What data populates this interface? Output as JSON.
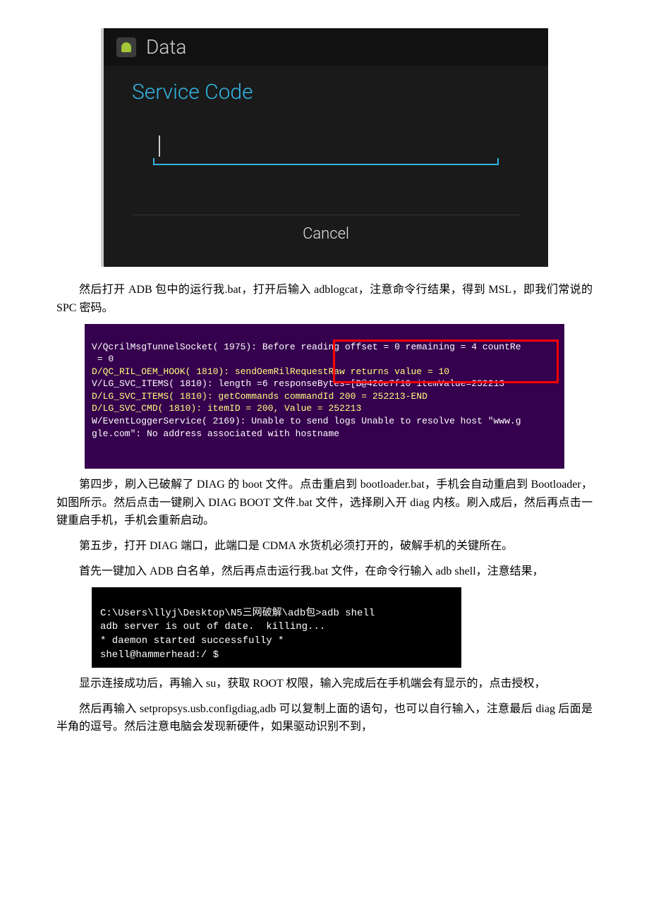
{
  "screenshot1": {
    "title": "Data",
    "label": "Service Code",
    "cancel": "Cancel"
  },
  "para1": "然后打开 ADB 包中的运行我.bat，打开后输入 adblogcat，注意命令行结果，得到 MSL，即我们常说的 SPC 密码。",
  "terminal1": {
    "l1a": "V/QcrilMsgTunnelSocket( 1975): Before reading offset = 0 remaining = 4 countRe",
    "l1b": " = 0",
    "l2": "D/QC_RIL_OEM_HOOK( 1810): sendOemRilRequestRaw returns value = 10",
    "l3": "V/LG_SVC_ITEMS( 1810): length =6 responseBytes=[B@426e7f10 itemValue=252213",
    "l4": "D/LG_SVC_ITEMS( 1810): getCommands commandId 200 = 252213-END",
    "l5": "D/LG_SVC_CMD( 1810): itemID = 200, Value = 252213",
    "l6a": "W/EventLoggerService( 2169): Unable to send logs Unable to resolve host \"www.g",
    "l6b": "gle.com\": No address associated with hostname"
  },
  "para2": "第四步，刷入已破解了 DIAG 的 boot 文件。点击重启到 bootloader.bat，手机会自动重启到 Bootloader，如图所示。然后点击一键刷入 DIAG BOOT 文件.bat 文件，选择刷入开 diag 内核。刷入成后，然后再点击一键重启手机，手机会重新启动。",
  "para3": "第五步，打开 DIAG 端口，此端口是 CDMA 水货机必须打开的，破解手机的关键所在。",
  "para4": "首先一键加入 ADB 白名单，然后再点击运行我.bat 文件，在命令行输入 adb shell，注意结果，",
  "terminal2": {
    "l1": "C:\\Users\\llyj\\Desktop\\N5三网破解\\adb包>adb shell",
    "l2": "adb server is out of date.  killing...",
    "l3": "* daemon started successfully *",
    "l4": "shell@hammerhead:/ $"
  },
  "para5": "显示连接成功后，再输入 su，获取 ROOT 权限，输入完成后在手机端会有显示的，点击授权，",
  "para6": "然后再输入 setpropsys.usb.configdiag,adb 可以复制上面的语句，也可以自行输入，注意最后 diag 后面是半角的逗号。然后注意电脑会发现新硬件，如果驱动识别不到，"
}
